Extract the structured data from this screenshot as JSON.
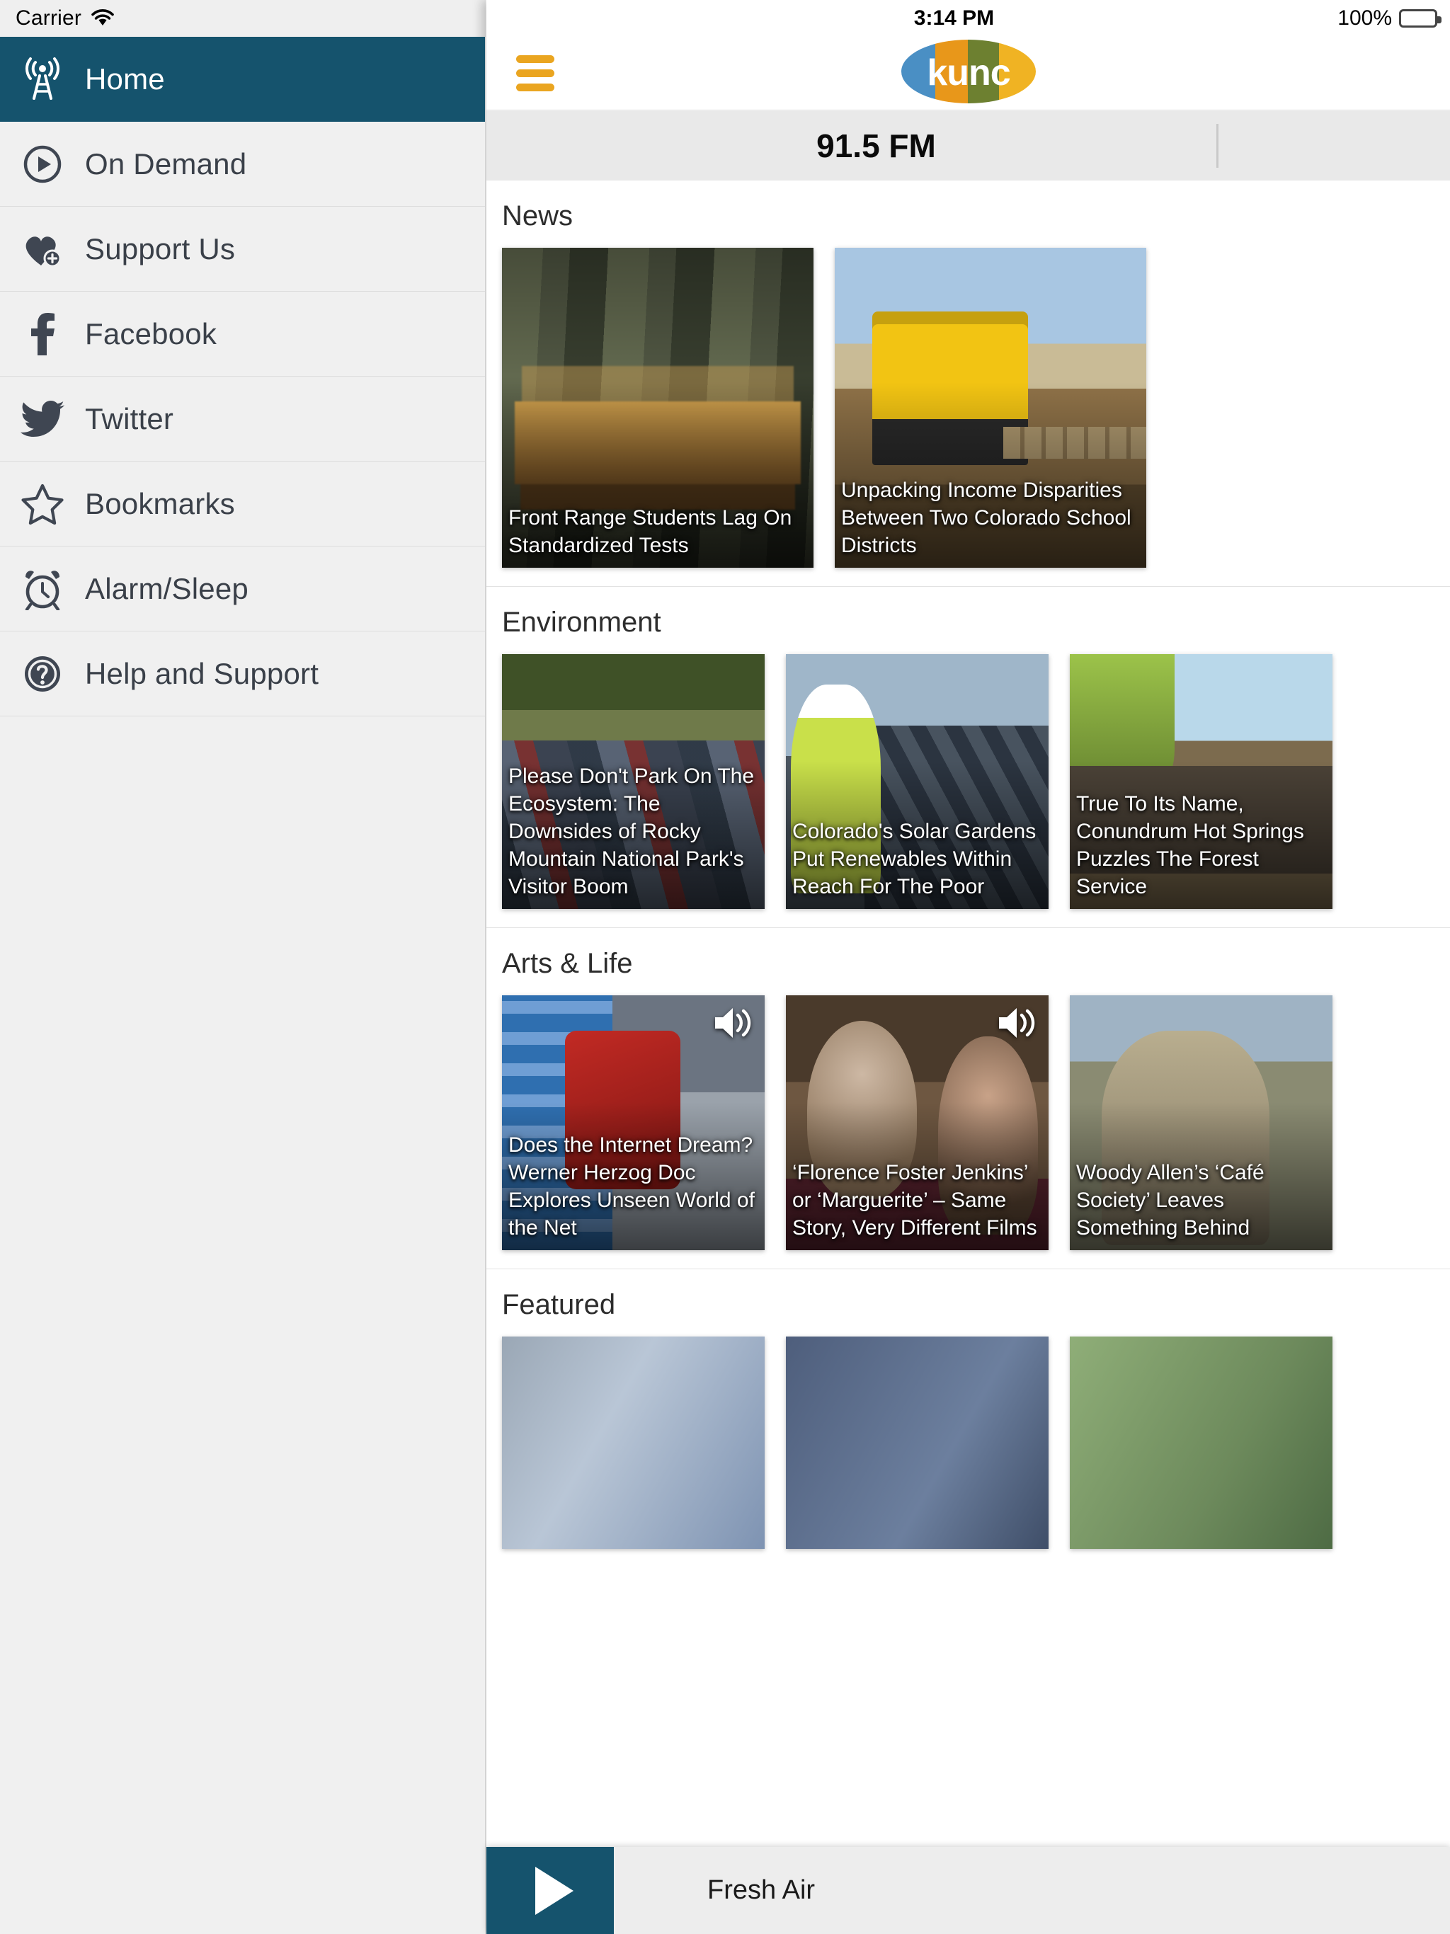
{
  "status": {
    "carrier": "Carrier",
    "time": "3:14 PM",
    "battery_pct": "100%",
    "wifi_icon": "wifi-icon"
  },
  "navbar": {
    "menu_icon": "hamburger-menu-icon",
    "logo_text": "kunc",
    "logo_name": "kunc-logo"
  },
  "station_bar": {
    "frequency": "91.5 FM"
  },
  "sidebar": {
    "items": [
      {
        "label": "Home",
        "icon": "broadcast-tower-icon",
        "active": true
      },
      {
        "label": "On Demand",
        "icon": "play-circle-icon",
        "active": false
      },
      {
        "label": "Support Us",
        "icon": "heart-plus-icon",
        "active": false
      },
      {
        "label": "Facebook",
        "icon": "facebook-icon",
        "active": false
      },
      {
        "label": "Twitter",
        "icon": "twitter-icon",
        "active": false
      },
      {
        "label": "Bookmarks",
        "icon": "star-outline-icon",
        "active": false
      },
      {
        "label": "Alarm/Sleep",
        "icon": "alarm-clock-icon",
        "active": false
      },
      {
        "label": "Help and Support",
        "icon": "question-circle-icon",
        "active": false
      }
    ]
  },
  "sections": [
    {
      "title": "News",
      "cards": [
        {
          "title": "Front Range Students Lag On Standardized Tests",
          "audio": false
        },
        {
          "title": "Unpacking Income Disparities Between Two Colorado School Districts",
          "audio": false
        }
      ]
    },
    {
      "title": "Environment",
      "cards": [
        {
          "title": "Please Don't Park On The Ecosystem: The Downsides of Rocky Mountain National Park's Visitor Boom",
          "audio": false
        },
        {
          "title": "Colorado's Solar Gardens Put Renewables Within Reach For The Poor",
          "audio": false
        },
        {
          "title": "True To Its Name, Conundrum Hot Springs Puzzles The Forest Service",
          "audio": false
        }
      ]
    },
    {
      "title": "Arts & Life",
      "cards": [
        {
          "title": "Does the Internet Dream? Werner Herzog Doc Explores Unseen World of the Net",
          "audio": true
        },
        {
          "title": "‘Florence Foster Jenkins’ or ‘Marguerite’ – Same Story, Very Different Films",
          "audio": true
        },
        {
          "title": "Woody Allen’s ‘Café Society’ Leaves Something Behind",
          "audio": false
        }
      ]
    },
    {
      "title": "Featured",
      "cards": [
        {
          "title": "",
          "audio": false
        },
        {
          "title": "",
          "audio": false
        },
        {
          "title": "",
          "audio": false
        }
      ]
    }
  ],
  "player": {
    "play_icon": "play-icon",
    "now_playing": "Fresh Air"
  },
  "colors": {
    "accent_teal": "#15536d",
    "accent_orange": "#eaa520",
    "sidebar_bg": "#f0f0f0",
    "station_bar_bg": "#e9e9e9"
  }
}
